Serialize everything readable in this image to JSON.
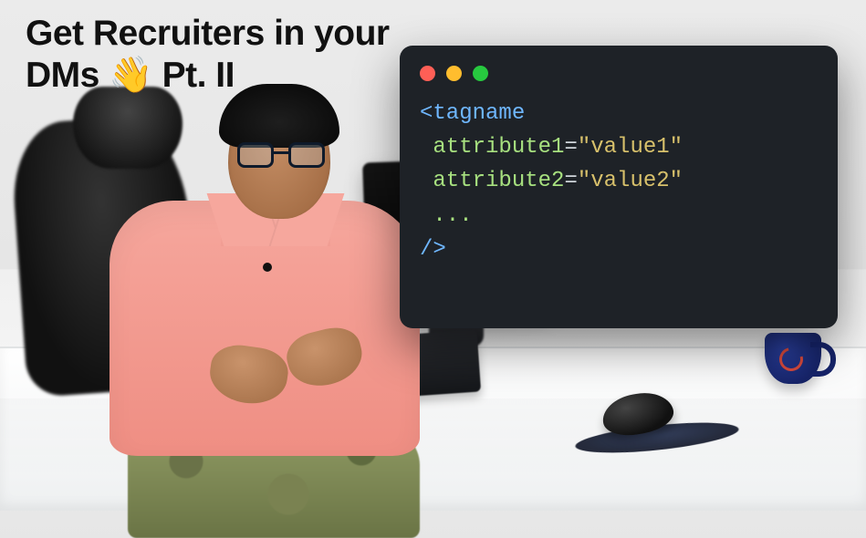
{
  "title": {
    "line1": "Get Recruiters in your",
    "line2_pre": "DMs ",
    "emoji": "👋",
    "line2_post": " Pt. II"
  },
  "code_panel": {
    "traffic_lights": [
      "red",
      "yellow",
      "green"
    ],
    "tokens": {
      "lt": "<",
      "tagname": "tagname",
      "attr1": "attribute1",
      "val1": "\"value1\"",
      "attr2": "attribute2",
      "val2": "\"value2\"",
      "eq": "=",
      "ellipsis": "...",
      "close": "/>"
    }
  }
}
